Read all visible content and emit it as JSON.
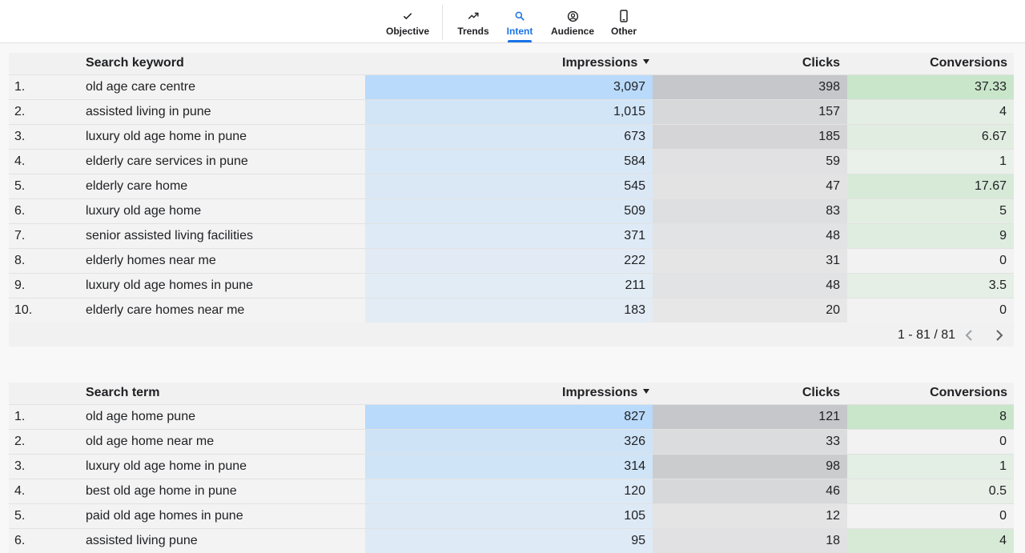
{
  "tabs": [
    {
      "label": "Objective",
      "icon": "check-icon"
    },
    {
      "label": "Trends",
      "icon": "trending-up-icon"
    },
    {
      "label": "Intent",
      "icon": "search-icon",
      "active": true
    },
    {
      "label": "Audience",
      "icon": "account-circle-icon"
    },
    {
      "label": "Other",
      "icon": "smartphone-icon"
    }
  ],
  "table1": {
    "headers": {
      "keyword": "Search keyword",
      "impressions": "Impressions",
      "clicks": "Clicks",
      "conversions": "Conversions"
    },
    "rows": [
      {
        "num": "1.",
        "keyword": "old age care centre",
        "impressions": "3,097",
        "clicks": "398",
        "conversions": "37.33"
      },
      {
        "num": "2.",
        "keyword": "assisted living in pune",
        "impressions": "1,015",
        "clicks": "157",
        "conversions": "4"
      },
      {
        "num": "3.",
        "keyword": "luxury old age home in pune",
        "impressions": "673",
        "clicks": "185",
        "conversions": "6.67"
      },
      {
        "num": "4.",
        "keyword": "elderly care services in pune",
        "impressions": "584",
        "clicks": "59",
        "conversions": "1"
      },
      {
        "num": "5.",
        "keyword": "elderly care home",
        "impressions": "545",
        "clicks": "47",
        "conversions": "17.67"
      },
      {
        "num": "6.",
        "keyword": "luxury old age home",
        "impressions": "509",
        "clicks": "83",
        "conversions": "5"
      },
      {
        "num": "7.",
        "keyword": "senior assisted living facilities",
        "impressions": "371",
        "clicks": "48",
        "conversions": "9"
      },
      {
        "num": "8.",
        "keyword": "elderly homes near me",
        "impressions": "222",
        "clicks": "31",
        "conversions": "0"
      },
      {
        "num": "9.",
        "keyword": "luxury old age homes in pune",
        "impressions": "211",
        "clicks": "48",
        "conversions": "3.5"
      },
      {
        "num": "10.",
        "keyword": "elderly care homes near me",
        "impressions": "183",
        "clicks": "20",
        "conversions": "0"
      }
    ],
    "pager": "1 - 81 / 81"
  },
  "table2": {
    "headers": {
      "keyword": "Search term",
      "impressions": "Impressions",
      "clicks": "Clicks",
      "conversions": "Conversions"
    },
    "rows": [
      {
        "num": "1.",
        "keyword": "old age home pune",
        "impressions": "827",
        "clicks": "121",
        "conversions": "8"
      },
      {
        "num": "2.",
        "keyword": "old age home near me",
        "impressions": "326",
        "clicks": "33",
        "conversions": "0"
      },
      {
        "num": "3.",
        "keyword": "luxury old age home in pune",
        "impressions": "314",
        "clicks": "98",
        "conversions": "1"
      },
      {
        "num": "4.",
        "keyword": "best old age home in pune",
        "impressions": "120",
        "clicks": "46",
        "conversions": "0.5"
      },
      {
        "num": "5.",
        "keyword": "paid old age homes in pune",
        "impressions": "105",
        "clicks": "12",
        "conversions": "0"
      },
      {
        "num": "6.",
        "keyword": "assisted living pune",
        "impressions": "95",
        "clicks": "18",
        "conversions": "4"
      }
    ]
  },
  "colors": {
    "impressions": "#b9dafa",
    "clicks": "#c6c7ca",
    "conversions": "#c9e6ca",
    "active_tab": "#1a73e8"
  }
}
